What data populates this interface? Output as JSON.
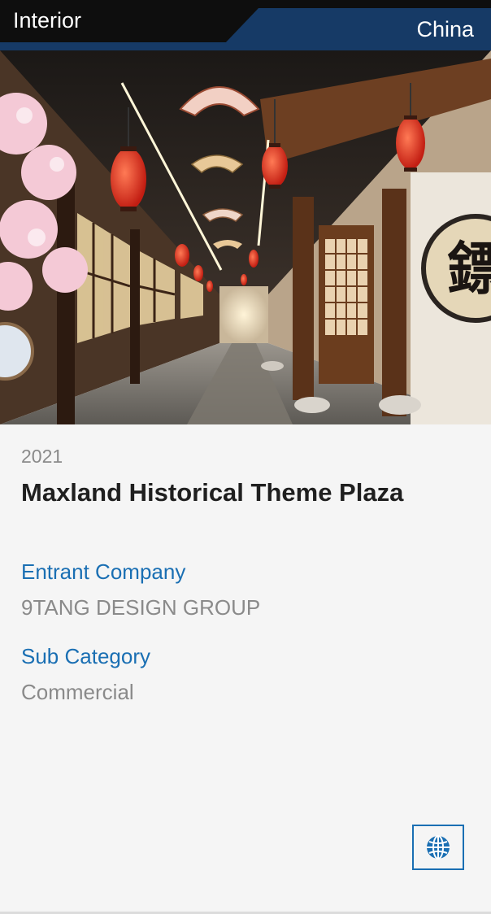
{
  "header": {
    "category": "Interior",
    "country": "China"
  },
  "hero": {
    "image_alt": "Chinese-style corridor with red lanterns and painted fans",
    "sign_glyph": "鏢"
  },
  "project": {
    "year": "2021",
    "title": "Maxland Historical Theme Plaza",
    "entrant_label": "Entrant Company",
    "entrant_value": "9TANG DESIGN GROUP",
    "subcategory_label": "Sub Category",
    "subcategory_value": "Commercial"
  },
  "actions": {
    "website_icon": "globe-icon"
  },
  "colors": {
    "topbar": "#0e0e0e",
    "country_tab": "#163a66",
    "label_blue": "#1a6fb3",
    "muted_text": "#8a8a8a"
  }
}
